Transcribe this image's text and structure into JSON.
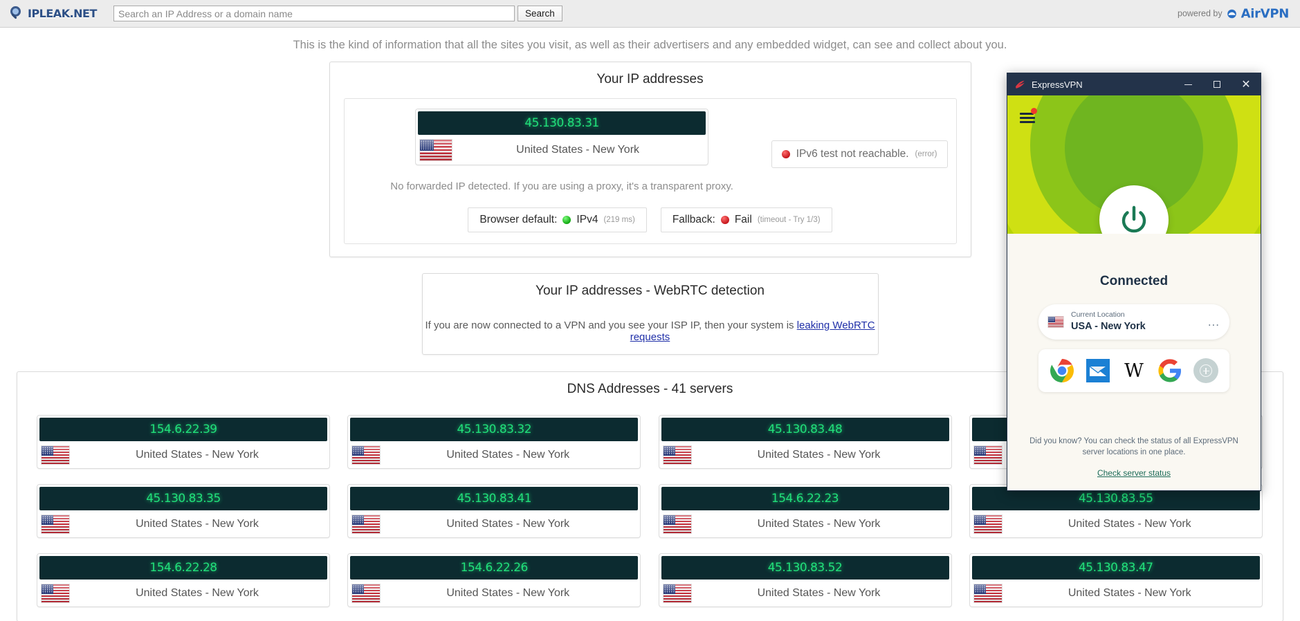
{
  "site": {
    "logo_text": "IPLEAK.NET",
    "powered_by_text": "powered by",
    "powered_by_brand": "AirVPN"
  },
  "search": {
    "placeholder": "Search an IP Address or a domain name",
    "value": "",
    "button_label": "Search"
  },
  "intro": "This is the kind of information that all the sites you visit, as well as their advertisers and any embedded widget, can see and collect about you.",
  "ip_panel": {
    "title": "Your IP addresses",
    "primary": {
      "ip": "45.130.83.31",
      "location": "United States - New York",
      "flag": "us-flag-icon"
    },
    "forwarded_note": "No forwarded IP detected. If you are using a proxy, it's a transparent proxy.",
    "ipv6": {
      "status_dot": "red",
      "text": "IPv6 test not reachable.",
      "detail": "(error)"
    },
    "status_boxes": [
      {
        "label": "Browser default:",
        "dot": "green",
        "value": "IPv4",
        "detail": "(219 ms)"
      },
      {
        "label": "Fallback:",
        "dot": "red",
        "value": "Fail",
        "detail": "(timeout - Try 1/3)"
      }
    ]
  },
  "webrtc_panel": {
    "title": "Your IP addresses - WebRTC detection",
    "text_before": "If you are now connected to a VPN and you see your ISP IP, then your system is ",
    "link_text": "leaking WebRTC requests"
  },
  "dns_panel": {
    "title": "DNS Addresses - 41 servers",
    "servers": [
      {
        "ip": "154.6.22.39",
        "location": "United States - New York"
      },
      {
        "ip": "45.130.83.32",
        "location": "United States - New York"
      },
      {
        "ip": "45.130.83.48",
        "location": "United States - New York"
      },
      {
        "ip": "",
        "location": ""
      },
      {
        "ip": "45.130.83.35",
        "location": "United States - New York"
      },
      {
        "ip": "45.130.83.41",
        "location": "United States - New York"
      },
      {
        "ip": "154.6.22.23",
        "location": "United States - New York"
      },
      {
        "ip": "45.130.83.55",
        "location": "United States - New York"
      },
      {
        "ip": "154.6.22.28",
        "location": "United States - New York"
      },
      {
        "ip": "154.6.22.26",
        "location": "United States - New York"
      },
      {
        "ip": "45.130.83.52",
        "location": "United States - New York"
      },
      {
        "ip": "45.130.83.47",
        "location": "United States - New York"
      }
    ]
  },
  "vpn_app": {
    "title": "ExpressVPN",
    "window_buttons": {
      "minimize": "minimize-icon",
      "maximize": "maximize-icon",
      "close": "close-icon"
    },
    "status": "Connected",
    "location": {
      "label": "Current Location",
      "value": "USA - New York",
      "flag": "us-flag-icon",
      "more": "..."
    },
    "shortcuts": [
      {
        "name": "chrome-shortcut"
      },
      {
        "name": "mail-shortcut"
      },
      {
        "name": "wikipedia-shortcut",
        "glyph": "W"
      },
      {
        "name": "google-shortcut",
        "glyph": "G"
      },
      {
        "name": "add-shortcut"
      }
    ],
    "footer": {
      "tip": "Did you know? You can check the status of all ExpressVPN server locations in one place.",
      "link": "Check server status"
    }
  },
  "colors": {
    "ip_value_green": "#21e07a",
    "ip_value_bg": "#0c2b30",
    "vpn_titlebar": "#23334a",
    "vpn_hero_green": "#b7d406",
    "vpn_accent": "#1c6b58",
    "airvpn_blue": "#2a6ec2",
    "link_blue": "#1f2fa8"
  }
}
